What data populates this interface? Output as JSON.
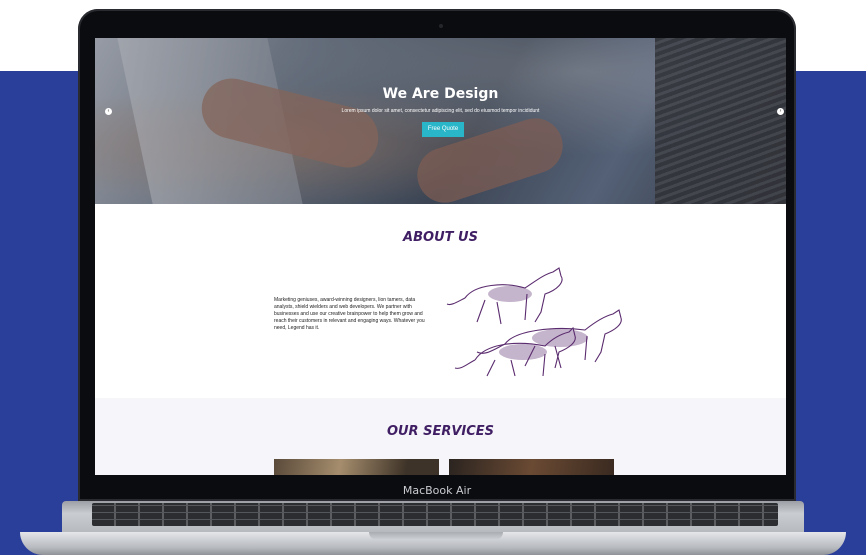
{
  "device": {
    "label": "MacBook Air"
  },
  "colors": {
    "accent": "#2ab6c9",
    "heading": "#3f1e63",
    "backdrop": "#2a3f9a"
  },
  "hero": {
    "title": "We Are Design",
    "subtitle": "Lorem ipsum dolor sit amet, consectetur adipiscing elit, sed do eiusmod tempor incididunt",
    "cta_label": "Free Quote",
    "prev_icon": "chevron-left-icon",
    "next_icon": "chevron-right-icon"
  },
  "about": {
    "title": "ABOUT US",
    "text": "Marketing geniuses, award-winning designers, lion tamers, data analysts, shield wielders and web developers. We partner with businesses and use our creative brainpower to help them grow and reach their customers in relevant and engaging ways. Whatever you need, Legend has it.",
    "illustration": "wolves-illustration"
  },
  "services": {
    "title": "OUR SERVICES"
  }
}
